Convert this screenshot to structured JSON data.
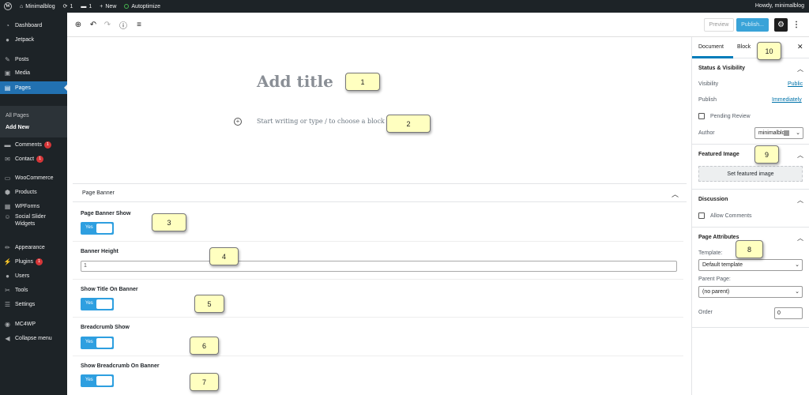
{
  "admin_bar": {
    "site_name": "Minimalblog",
    "updates_count": "1",
    "comments_count": "1",
    "new_label": "New",
    "autoptimize_label": "Autoptimize",
    "greeting": "Howdy, minimalblog"
  },
  "sidebar": {
    "items": [
      {
        "label": "Dashboard",
        "icon": "gauge-icon"
      },
      {
        "label": "Jetpack",
        "icon": "jetpack-icon"
      },
      {
        "label": "Posts",
        "icon": "pin-icon"
      },
      {
        "label": "Media",
        "icon": "media-icon"
      },
      {
        "label": "Pages",
        "icon": "pages-icon",
        "active": true
      },
      {
        "label": "Comments",
        "icon": "comment-icon",
        "badge": "1"
      },
      {
        "label": "Contact",
        "icon": "mail-icon",
        "badge": "1"
      },
      {
        "label": "WooCommerce",
        "icon": "woo-icon"
      },
      {
        "label": "Products",
        "icon": "products-icon"
      },
      {
        "label": "WPForms",
        "icon": "forms-icon"
      },
      {
        "label": "Social Slider",
        "label2": "Widgets",
        "icon": "social-icon"
      },
      {
        "label": "Appearance",
        "icon": "brush-icon"
      },
      {
        "label": "Plugins",
        "icon": "plug-icon",
        "badge": "1"
      },
      {
        "label": "Users",
        "icon": "user-icon"
      },
      {
        "label": "Tools",
        "icon": "wrench-icon"
      },
      {
        "label": "Settings",
        "icon": "sliders-icon"
      },
      {
        "label": "MC4WP",
        "icon": "mc4wp-icon"
      },
      {
        "label": "Collapse menu",
        "icon": "collapse-icon"
      }
    ],
    "submenu": [
      "All Pages",
      "Add New"
    ]
  },
  "toolbar": {
    "preview_label": "Preview",
    "publish_label": "Publish..."
  },
  "editor": {
    "title_placeholder": "Add title",
    "block_placeholder": "Start writing or type / to choose a block"
  },
  "page_banner": {
    "heading": "Page Banner",
    "fields": [
      {
        "label": "Page Banner Show",
        "type": "toggle",
        "value": "Yes"
      },
      {
        "label": "Banner Height",
        "type": "text",
        "value": "1"
      },
      {
        "label": "Show Title On Banner",
        "type": "toggle",
        "value": "Yes"
      },
      {
        "label": "Breadcrumb Show",
        "type": "toggle",
        "value": "Yes"
      },
      {
        "label": "Show Breadcrumb On Banner",
        "type": "toggle",
        "value": "Yes"
      }
    ]
  },
  "settings_panel": {
    "tabs": [
      "Document",
      "Block"
    ],
    "status": {
      "heading": "Status & Visibility",
      "visibility_label": "Visibility",
      "visibility_value": "Public",
      "publish_label": "Publish",
      "publish_value": "Immediately",
      "pending_label": "Pending Review",
      "author_label": "Author",
      "author_value": "minimalblog"
    },
    "featured": {
      "heading": "Featured Image",
      "button": "Set featured image"
    },
    "discussion": {
      "heading": "Discussion",
      "allow_label": "Allow Comments"
    },
    "attributes": {
      "heading": "Page Attributes",
      "template_label": "Template:",
      "template_value": "Default template",
      "parent_label": "Parent Page:",
      "parent_value": "(no parent)",
      "order_label": "Order",
      "order_value": "0"
    }
  },
  "callouts": [
    "1",
    "2",
    "3",
    "4",
    "5",
    "6",
    "7",
    "8",
    "9",
    "10"
  ],
  "colors": {
    "accent": "#2271b1",
    "publish": "#39a3d8",
    "toggle": "#2e9fe0",
    "callout_bg": "#ffffc0"
  }
}
